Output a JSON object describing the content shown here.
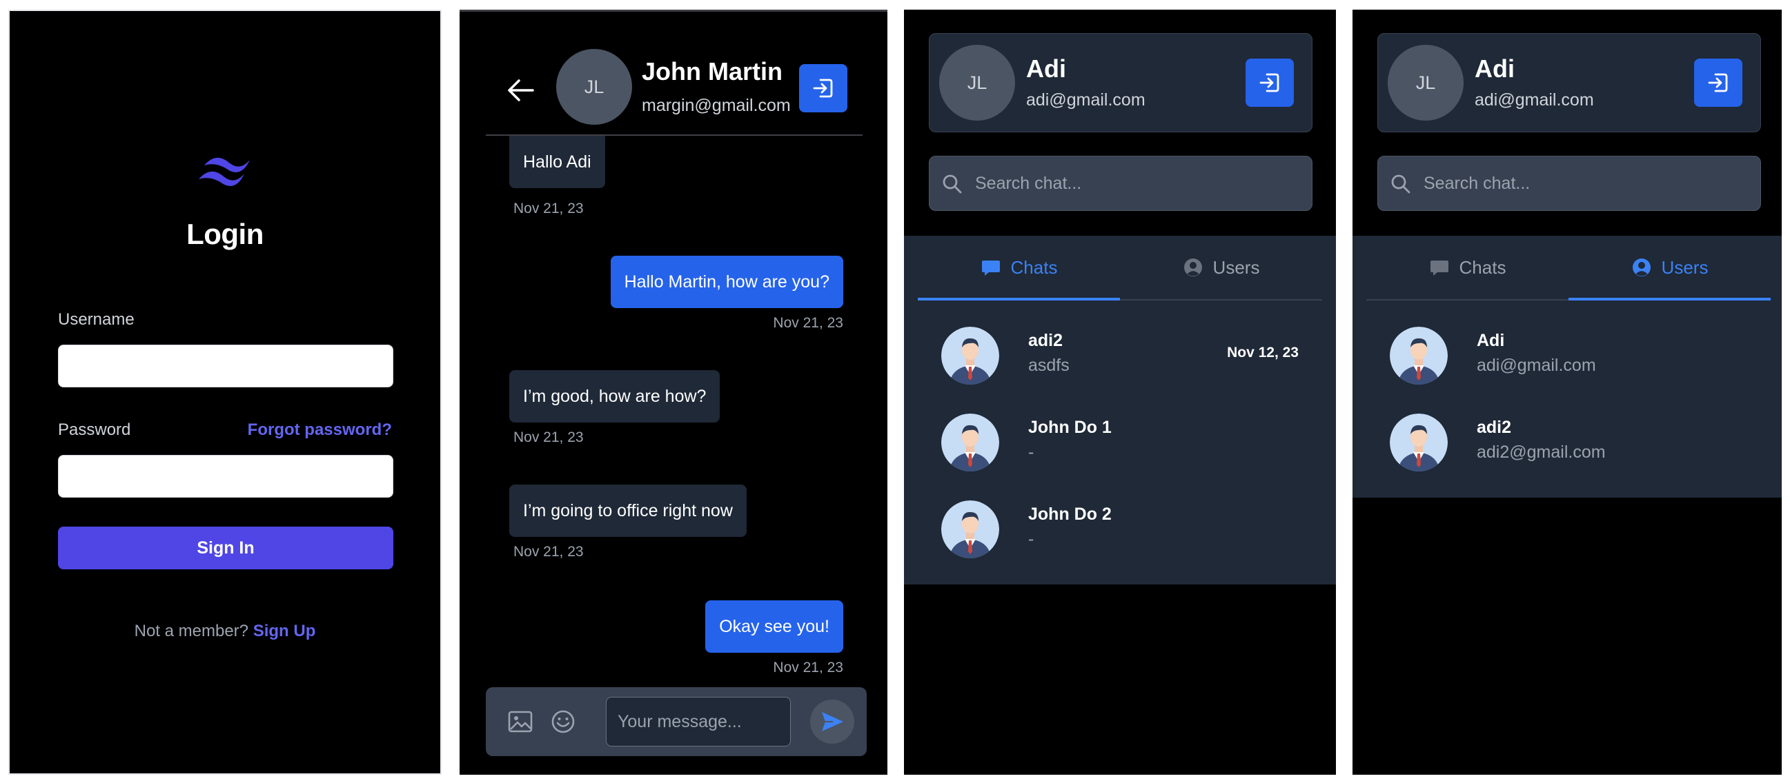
{
  "login": {
    "title": "Login",
    "username_label": "Username",
    "password_label": "Password",
    "forgot_label": "Forgot password?",
    "signin_label": "Sign In",
    "not_member_text": "Not a member?",
    "signup_label": "Sign Up",
    "logo_icon": "tailwind-logo-icon",
    "brand_color": "#4f46e5"
  },
  "conversation": {
    "contact_initials": "JL",
    "contact_name": "John Martin",
    "contact_email": "margin@gmail.com",
    "messages": [
      {
        "direction": "incoming",
        "text": "Hallo Adi",
        "time": "Nov 21, 23"
      },
      {
        "direction": "outgoing",
        "text": "Hallo Martin, how are you?",
        "time": "Nov 21, 23"
      },
      {
        "direction": "incoming",
        "text": "I’m good, how are how?",
        "time": "Nov 21, 23"
      },
      {
        "direction": "incoming",
        "text": "I’m going to office right now",
        "time": "Nov 21, 23"
      },
      {
        "direction": "outgoing",
        "text": "Okay see you!",
        "time": "Nov 21, 23"
      }
    ],
    "message_placeholder": "Your message...",
    "accent_color": "#2563eb"
  },
  "chats_view": {
    "profile_initials": "JL",
    "profile_name": "Adi",
    "profile_email": "adi@gmail.com",
    "search_placeholder": "Search chat...",
    "tab_chats": "Chats",
    "tab_users": "Users",
    "active_tab": "chats",
    "items": [
      {
        "name": "adi2",
        "preview": "asdfs",
        "date": "Nov 12, 23"
      },
      {
        "name": "John Do 1",
        "preview": "-",
        "date": ""
      },
      {
        "name": "John Do 2",
        "preview": "-",
        "date": ""
      }
    ]
  },
  "users_view": {
    "profile_initials": "JL",
    "profile_name": "Adi",
    "profile_email": "adi@gmail.com",
    "search_placeholder": "Search chat...",
    "tab_chats": "Chats",
    "tab_users": "Users",
    "active_tab": "users",
    "items": [
      {
        "name": "Adi",
        "email": "adi@gmail.com"
      },
      {
        "name": "adi2",
        "email": "adi2@gmail.com"
      }
    ]
  },
  "icons": {
    "logout": "logout-icon",
    "back": "arrow-left-icon",
    "image": "image-icon",
    "emoji": "smiley-icon",
    "send": "send-icon",
    "search": "search-icon",
    "chat_tab": "chat-bubble-icon",
    "users_tab": "user-circle-icon",
    "user_avatar": "businessman-avatar-icon"
  }
}
